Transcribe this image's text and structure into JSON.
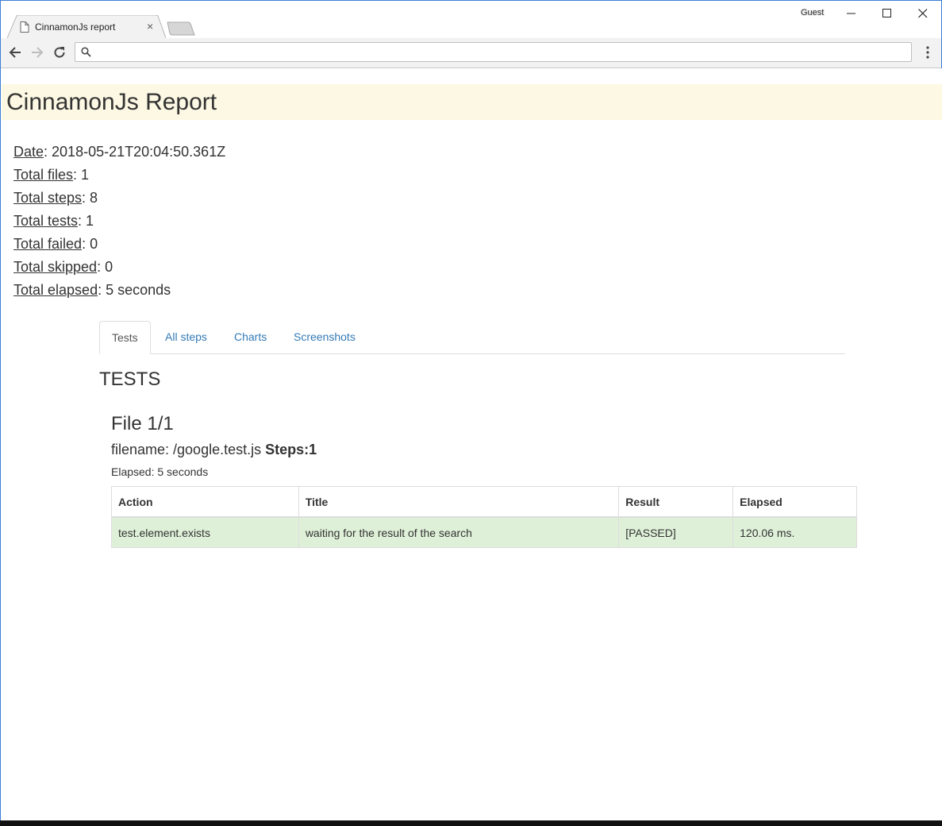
{
  "browser": {
    "tab_title": "CinnamonJs report",
    "tab_close": "×",
    "profile": "Guest",
    "address_value": "",
    "icons": {
      "favicon": "page-icon",
      "back": "back-arrow-icon",
      "forward": "forward-arrow-icon",
      "reload": "reload-icon",
      "search": "search-icon",
      "menu": "vertical-dots-icon",
      "minimize": "minimize-icon",
      "maximize": "maximize-icon",
      "close": "close-icon"
    }
  },
  "report": {
    "title": "CinnamonJs Report",
    "header_bg": "#fcf8e3",
    "summary": [
      {
        "label": "Date",
        "value": ": 2018-05-21T20:04:50.361Z"
      },
      {
        "label": "Total files",
        "value": ": 1"
      },
      {
        "label": "Total steps",
        "value": ": 8"
      },
      {
        "label": "Total tests",
        "value": ": 1"
      },
      {
        "label": "Total failed",
        "value": ": 0"
      },
      {
        "label": "Total skipped",
        "value": ": 0"
      },
      {
        "label": "Total elapsed",
        "value": ": 5 seconds"
      }
    ],
    "tabs": [
      "Tests",
      "All steps",
      "Charts",
      "Screenshots"
    ],
    "active_tab": "Tests",
    "section_title": "TESTS",
    "file": {
      "title": "File 1/1",
      "filename": "filename: /google.test.js",
      "steps": "Steps:1",
      "elapsed": "Elapsed: 5 seconds",
      "columns": [
        "Action",
        "Title",
        "Result",
        "Elapsed"
      ],
      "rows": [
        {
          "action": "test.element.exists",
          "title": "waiting for the result of the search",
          "result": "[PASSED]",
          "elapsed": "120.06 ms."
        }
      ],
      "passed_color": "#dff0d8"
    }
  }
}
